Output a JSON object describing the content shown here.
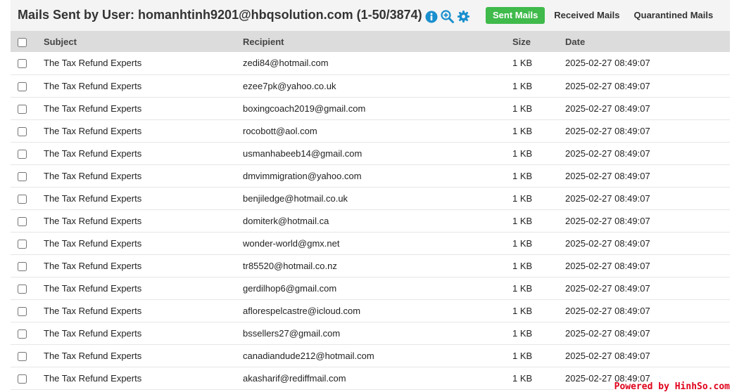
{
  "header": {
    "title": "Mails Sent by User: homanhtinh9201@hbqsolution.com (1-50/3874)",
    "icons": [
      "info-icon",
      "zoom-in-icon",
      "gear-icon"
    ],
    "tabs": [
      {
        "label": "Sent Mails",
        "active": true
      },
      {
        "label": "Received Mails",
        "active": false
      },
      {
        "label": "Quarantined Mails",
        "active": false
      }
    ]
  },
  "table": {
    "columns": [
      "Subject",
      "Recipient",
      "Size",
      "Date"
    ],
    "rows": [
      {
        "subject": "The Tax Refund Experts",
        "recipient": "zedi84@hotmail.com",
        "size": "1 KB",
        "date": "2025-02-27 08:49:07"
      },
      {
        "subject": "The Tax Refund Experts",
        "recipient": "ezee7pk@yahoo.co.uk",
        "size": "1 KB",
        "date": "2025-02-27 08:49:07"
      },
      {
        "subject": "The Tax Refund Experts",
        "recipient": "boxingcoach2019@gmail.com",
        "size": "1 KB",
        "date": "2025-02-27 08:49:07"
      },
      {
        "subject": "The Tax Refund Experts",
        "recipient": "rocobott@aol.com",
        "size": "1 KB",
        "date": "2025-02-27 08:49:07"
      },
      {
        "subject": "The Tax Refund Experts",
        "recipient": "usmanhabeeb14@gmail.com",
        "size": "1 KB",
        "date": "2025-02-27 08:49:07"
      },
      {
        "subject": "The Tax Refund Experts",
        "recipient": "dmvimmigration@yahoo.com",
        "size": "1 KB",
        "date": "2025-02-27 08:49:07"
      },
      {
        "subject": "The Tax Refund Experts",
        "recipient": "benjiledge@hotmail.co.uk",
        "size": "1 KB",
        "date": "2025-02-27 08:49:07"
      },
      {
        "subject": "The Tax Refund Experts",
        "recipient": "domiterk@hotmail.ca",
        "size": "1 KB",
        "date": "2025-02-27 08:49:07"
      },
      {
        "subject": "The Tax Refund Experts",
        "recipient": "wonder-world@gmx.net",
        "size": "1 KB",
        "date": "2025-02-27 08:49:07"
      },
      {
        "subject": "The Tax Refund Experts",
        "recipient": "tr85520@hotmail.co.nz",
        "size": "1 KB",
        "date": "2025-02-27 08:49:07"
      },
      {
        "subject": "The Tax Refund Experts",
        "recipient": "gerdilhop6@gmail.com",
        "size": "1 KB",
        "date": "2025-02-27 08:49:07"
      },
      {
        "subject": "The Tax Refund Experts",
        "recipient": "aflorespelcastre@icloud.com",
        "size": "1 KB",
        "date": "2025-02-27 08:49:07"
      },
      {
        "subject": "The Tax Refund Experts",
        "recipient": "bssellers27@gmail.com",
        "size": "1 KB",
        "date": "2025-02-27 08:49:07"
      },
      {
        "subject": "The Tax Refund Experts",
        "recipient": "canadiandude212@hotmail.com",
        "size": "1 KB",
        "date": "2025-02-27 08:49:07"
      },
      {
        "subject": "The Tax Refund Experts",
        "recipient": "akasharif@rediffmail.com",
        "size": "1 KB",
        "date": "2025-02-27 08:49:07"
      }
    ]
  },
  "watermark": "Powered by HinhSo.com",
  "colors": {
    "tab_active": "#3fba4b",
    "icon_blue": "#1a8fce",
    "header_bg": "#f4f4f4",
    "table_header_bg": "#dcdcdc",
    "watermark": "#e0001a"
  }
}
